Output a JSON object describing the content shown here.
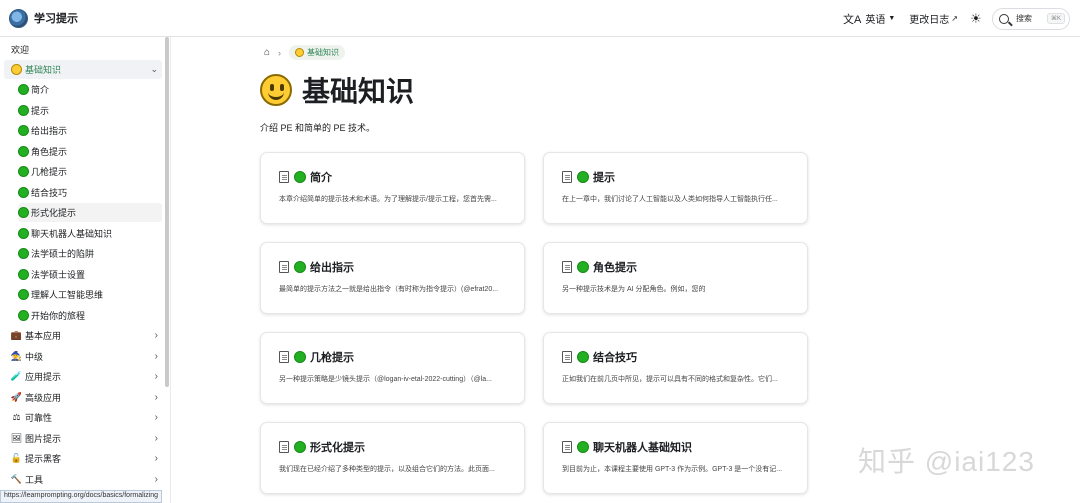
{
  "header": {
    "brand_title": "学习提示",
    "language": "英语",
    "changelog": "更改日志",
    "search_label": "搜索",
    "search_kbd": "⌘K"
  },
  "sidebar": {
    "welcome": "欢迎",
    "basics": "基础知识",
    "sub_items": [
      "简介",
      "提示",
      "给出指示",
      "角色提示",
      "几枪提示",
      "结合技巧",
      "形式化提示",
      "聊天机器人基础知识",
      "法学硕士的陷阱",
      "法学硕士设置",
      "理解人工智能思维",
      "开始你的旅程"
    ],
    "sections": [
      {
        "icon": "💼",
        "label": "基本应用"
      },
      {
        "icon": "🧙",
        "label": "中级"
      },
      {
        "icon": "🧪",
        "label": "应用提示"
      },
      {
        "icon": "🚀",
        "label": "高级应用"
      },
      {
        "icon": "⚖",
        "label": "可靠性"
      },
      {
        "icon": "🖼",
        "label": "图片提示"
      },
      {
        "icon": "🔓",
        "label": "提示黑客"
      },
      {
        "icon": "🔨",
        "label": "工具"
      }
    ]
  },
  "status_url": "https://learnprompting.org/docs/basics/formalizing",
  "main": {
    "breadcrumb_label": "基础知识",
    "title": "基础知识",
    "description": "介绍 PE 和简单的 PE 技术。",
    "cards": [
      {
        "title": "简介",
        "desc": "本章介绍简单的提示技术和术语。为了理解提示/提示工程，您首先需..."
      },
      {
        "title": "提示",
        "desc": "在上一章中，我们讨论了人工智能以及人类如何指导人工智能执行任..."
      },
      {
        "title": "给出指示",
        "desc": "最简单的提示方法之一就是给出指令（有时称为指令提示）(@efrat20..."
      },
      {
        "title": "角色提示",
        "desc": "另一种提示技术是为 AI 分配角色。例如，您的"
      },
      {
        "title": "几枪提示",
        "desc": "另一种提示策略是少镜头提示（@logan-iv-etal-2022-cutting）（@la..."
      },
      {
        "title": "结合技巧",
        "desc": "正如我们在前几页中所见，提示可以具有不同的格式和复杂性。它们..."
      },
      {
        "title": "形式化提示",
        "desc": "我们现在已经介绍了多种类型的提示，以及组合它们的方法。此页面..."
      },
      {
        "title": "聊天机器人基础知识",
        "desc": "到目前为止，本课程主要使用 GPT-3 作为示例。GPT-3 是一个没有记..."
      }
    ]
  },
  "watermark": "知乎 @iai123"
}
